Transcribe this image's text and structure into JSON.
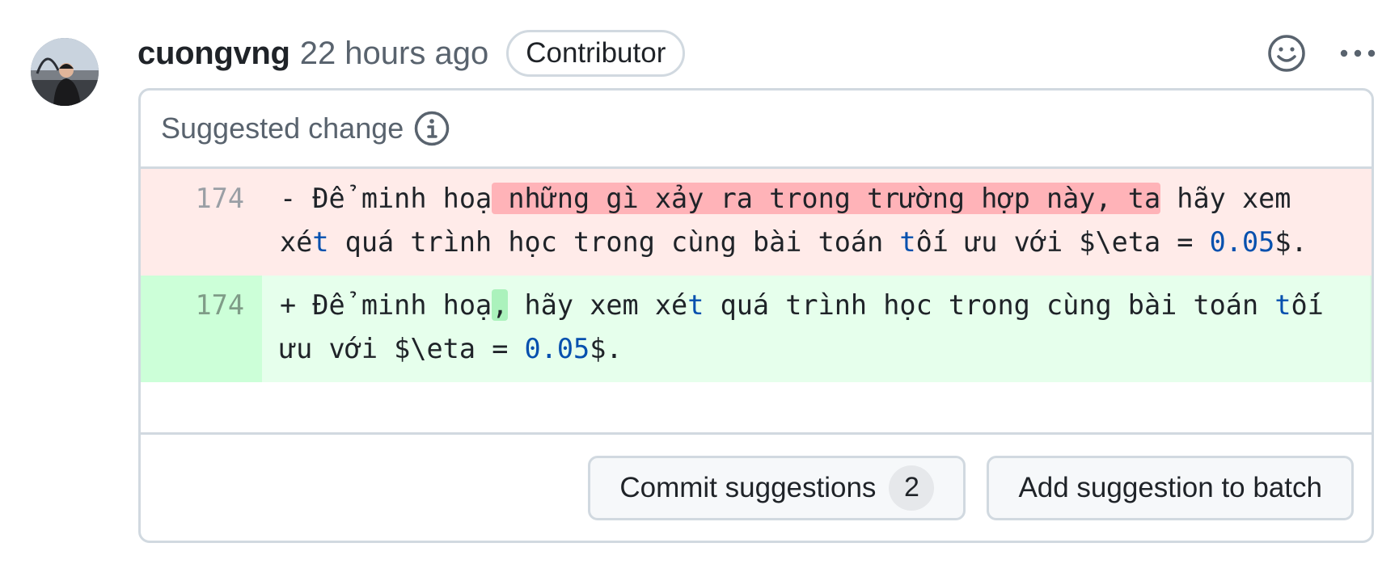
{
  "comment": {
    "author": "cuongvng",
    "time": "22 hours ago",
    "badge": "Contributor"
  },
  "icons": {
    "avatar": "user-avatar",
    "reaction": "smiley-icon",
    "more": "kebab-horizontal-icon",
    "info": "info-icon"
  },
  "suggestion": {
    "title": "Suggested change",
    "removed": {
      "line_number": "174",
      "segments": [
        {
          "text": "- Để minh hoạ",
          "hl": false
        },
        {
          "text": " những gì xảy ra trong trường hợp này, ta",
          "hl": true
        },
        {
          "text": " hãy xem xét quá trình học trong cùng bài toán tối ưu với $\\eta = 0.05$.",
          "hl": false
        }
      ]
    },
    "added": {
      "line_number": "174",
      "segments": [
        {
          "text": "+ Để minh hoạ",
          "hl": false
        },
        {
          "text": ",",
          "hl": true
        },
        {
          "text": " hãy xem xét quá trình học trong cùng bài toán tối ưu với $\\eta = 0.05$.",
          "hl": false
        }
      ]
    }
  },
  "actions": {
    "commit_label": "Commit suggestions",
    "commit_count": "2",
    "batch_label": "Add suggestion to batch"
  },
  "colors": {
    "deletion_bg": "#ffebe9",
    "deletion_highlight": "#ffb3b8",
    "addition_bg": "#e6ffec",
    "addition_highlight": "#abf2bc",
    "syntax_blue": "#0550ae"
  }
}
